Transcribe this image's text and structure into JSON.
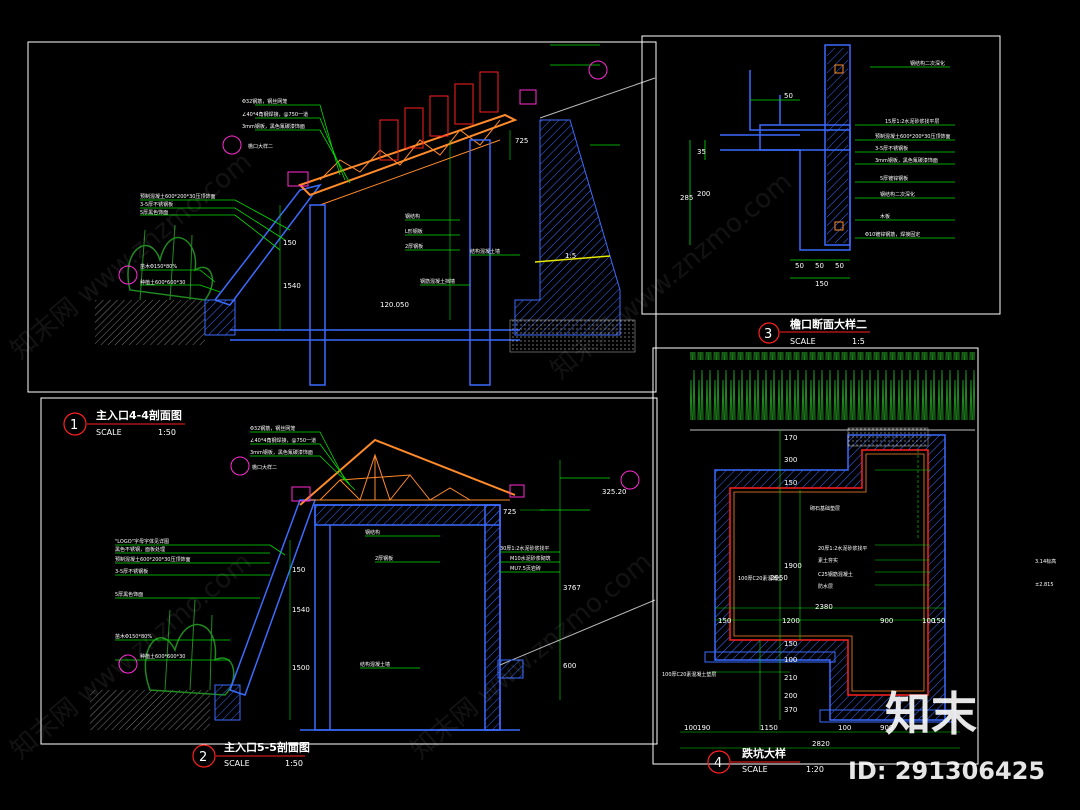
{
  "drawing": {
    "panel1": {
      "number": "1",
      "title": "主入口4-4剖面图",
      "scale_label": "SCALE",
      "scale_value": "1:50",
      "dims": [
        "725",
        "150",
        "1540",
        "120.050",
        "1:5"
      ],
      "leaders": [
        "Φ32钢筋，钢丝网笼",
        "∠40*4角钢焊接，@750一道",
        "3mm钢板，黑色氟碳漆饰面",
        "檐口大样二",
        "预制混凝土600*200*30压顶饰面",
        "3-5厚不锈钢板",
        "5厚黑色饰面",
        "苗木Φ150*80%",
        "种植土600*600*30",
        "钢结构",
        "L形钢板",
        "2厚钢板",
        "结构混凝土墙",
        "钢筋混凝土挡墙"
      ]
    },
    "panel2": {
      "number": "2",
      "title": "主入口5-5剖面图",
      "scale_label": "SCALE",
      "scale_value": "1:50",
      "dims": [
        "325.20",
        "725",
        "150",
        "1540",
        "1500",
        "3767",
        "600"
      ],
      "leaders": [
        "Φ32钢筋，钢丝网笼",
        "∠40*4角钢焊接，@750一道",
        "3mm钢板，黑色氟碳漆饰面",
        "檐口大样二",
        "\"LOGO\"字母字体见详图",
        "黑色不锈钢，面板处理",
        "预制混凝土600*200*30压顶饰面",
        "3-5厚不锈钢板",
        "5厚黑色饰面",
        "苗木Φ150*80%",
        "种植土600*600*30",
        "钢结构",
        "2厚钢板",
        "30厚1:2水泥砂浆找平",
        "M10水泥砂浆砌筑",
        "MU7.5页岩砖",
        "结构混凝土墙"
      ]
    },
    "panel3": {
      "number": "3",
      "title": "檐口断面大样二",
      "scale_label": "SCALE",
      "scale_value": "1:5",
      "dims": [
        "50",
        "35",
        "200",
        "285",
        "50",
        "50",
        "50",
        "150"
      ],
      "leaders": [
        "钢结构二次深化",
        "15厚1:2水泥砂浆找平层",
        "预制混凝土600*200*30压顶饰面",
        "3-5厚不锈钢板",
        "3mm钢板，黑色氟碳漆饰面",
        "5厚镀锌钢板",
        "钢结构二次深化",
        "木板",
        "Φ10镀锌钢筋，焊接固定"
      ]
    },
    "panel4": {
      "number": "4",
      "title": "跌坑大样",
      "scale_label": "SCALE",
      "scale_value": "1:20",
      "dims": [
        "170",
        "300",
        "150",
        "1900",
        "2950",
        "150",
        "1200",
        "2380",
        "900",
        "100",
        "150",
        "150",
        "100",
        "210",
        "200",
        "370",
        "100",
        "1150",
        "2820",
        "900",
        "100",
        "190"
      ],
      "leaders": [
        "砌石基础垫层",
        "20厚1:2水泥砂浆找平",
        "素土夯实",
        "100厚C20素混凝土",
        "防水层",
        "C25钢筋混凝土",
        "100厚C20素混凝土垫层"
      ],
      "side_note": [
        "3.14标高",
        "±2.815"
      ]
    },
    "watermark": {
      "text": "知末网 www.znzmo.com",
      "brand": "知末",
      "id_text": "ID: 291306425"
    }
  },
  "colors": {
    "background": "#000000",
    "frame": "#ffffff",
    "wall": "#3b6bff",
    "leader": "#00e000",
    "roof": "#ff8a2a",
    "annotation": "#ff2ad4",
    "red": "#ff2020",
    "foliage": "#1f8a1f"
  }
}
